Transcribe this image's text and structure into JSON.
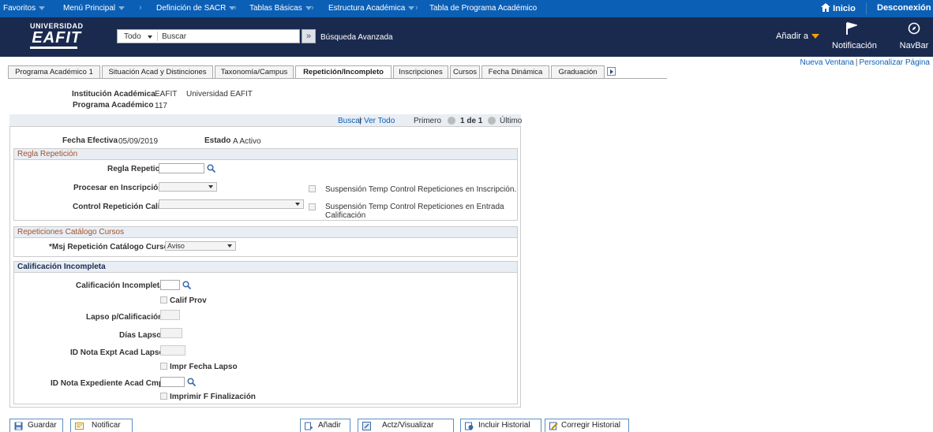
{
  "topbar": {
    "items": [
      "Favoritos",
      "Menú Principal",
      "Definición de SACR",
      "Tablas Básicas",
      "Estructura Académica",
      "Tabla de Programa Académico"
    ],
    "home": "Inicio",
    "logout": "Desconexión"
  },
  "header": {
    "logo_top": "UNIVERSIDAD",
    "logo_main": "EAFIT",
    "search_scope": "Todo",
    "search_placeholder": "Buscar",
    "advanced_search": "Búsqueda Avanzada",
    "add_to": "Añadir a",
    "notifications": "Notificación",
    "navbar": "NavBar"
  },
  "page_links": {
    "new_window": "Nueva Ventana",
    "personalize": "Personalizar Página"
  },
  "tabs": [
    "Programa Académico 1",
    "Situación Acad y Distinciones",
    "Taxonomía/Campus",
    "Repetición/Incompleto",
    "Inscripciones",
    "Cursos",
    "Fecha Dinámica",
    "Graduación"
  ],
  "info": {
    "institution_label": "Institución Académica",
    "institution_code": "EAFIT",
    "institution_name": "Universidad EAFIT",
    "program_label": "Programa Académico",
    "program_value": "117"
  },
  "nav": {
    "find": "Buscar",
    "view_all": "Ver Todo",
    "first": "Primero",
    "page": "1 de 1",
    "last": "Último"
  },
  "effdt": {
    "label": "Fecha Efectiva",
    "value": "05/09/2019",
    "status_label": "Estado",
    "status_value": "A Activo"
  },
  "repeat_rule": {
    "title": "Regla Repetición",
    "rule_label": "Regla Repetición",
    "process_label": "Procesar en Inscripción",
    "control_label": "Control Repetición Calif",
    "suspend_enroll": "Suspensión Temp Control Repeticiones en Inscripción.",
    "suspend_grade_1": "Suspensión Temp Control Repeticiones en Entrada",
    "suspend_grade_2": "Calificación"
  },
  "catalog": {
    "title": "Repeticiones Catálogo Cursos",
    "msg_label": "*Msj Repetición Catálogo Cursos",
    "msg_value": "Aviso"
  },
  "incomplete": {
    "title": "Calificación Incompleta",
    "grade_label": "Calificación Incompleta",
    "prov_label": "Calif Prov",
    "lapse_grade_label": "Lapso p/Calificación",
    "lapse_days_label": "Días Lapso",
    "note_lapse_label": "ID Nota Expt Acad Lapso",
    "print_lapse_label": "Impr Fecha Lapso",
    "note_complete_label": "ID Nota Expediente Acad Cmpl",
    "print_end_label": "Imprimir F Finalización"
  },
  "buttons": {
    "save": "Guardar",
    "notify": "Notificar",
    "add": "Añadir",
    "update": "Actz/Visualizar",
    "include_history": "Incluir Historial",
    "correct_history": "Corregir Historial"
  }
}
